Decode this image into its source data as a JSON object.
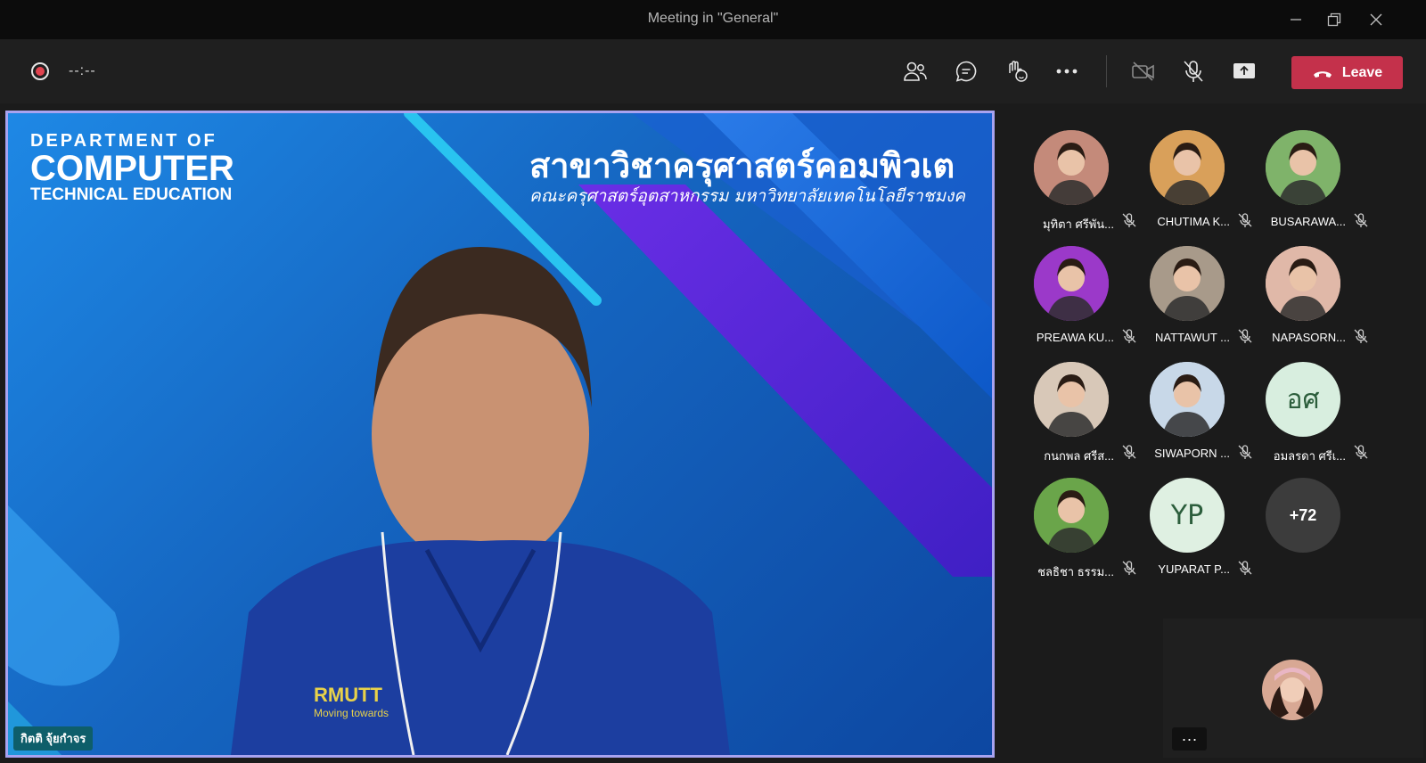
{
  "window": {
    "title": "Meeting in \"General\""
  },
  "toolbar": {
    "timer": "--:--",
    "leave_label": "Leave"
  },
  "stage": {
    "dept_line1": "DEPARTMENT OF",
    "dept_line2": "COMPUTER",
    "dept_line3": "TECHNICAL EDUCATION",
    "thai_title": "สาขาวิชาครุศาสตร์คอมพิวเต",
    "thai_subtitle": "คณะครุศาสตร์อุตสาหกรรม มหาวิทยาลัยเทคโนโลยีราชมงค",
    "shirt_logo": "RMUTT",
    "shirt_tagline": "Moving towards",
    "speaker_name": "กิตติ จุ้ยกำจร"
  },
  "participants": [
    {
      "name": "มุทิตา ศรีพัน...",
      "type": "photo",
      "color": "#c48a7a"
    },
    {
      "name": "CHUTIMA K...",
      "type": "photo",
      "color": "#d9a05a"
    },
    {
      "name": "BUSARAWA...",
      "type": "photo",
      "color": "#7fb36a"
    },
    {
      "name": "PREAWA KU...",
      "type": "photo",
      "color": "#9b39c9"
    },
    {
      "name": "NATTAWUT ...",
      "type": "photo",
      "color": "#a89a8a"
    },
    {
      "name": "NAPASORN...",
      "type": "photo",
      "color": "#e0b8a8"
    },
    {
      "name": "กนกพล ศรีส...",
      "type": "photo",
      "color": "#d8c8b8"
    },
    {
      "name": "SIWAPORN ...",
      "type": "photo",
      "color": "#c8d8e8"
    },
    {
      "name": "อมลรดา ศรีเ...",
      "type": "initials",
      "initials": "อศ",
      "color": "#d8eedf"
    },
    {
      "name": "ชลธิชา ธรรม...",
      "type": "photo",
      "color": "#6aa54a"
    },
    {
      "name": "YUPARAT P...",
      "type": "initials",
      "initials": "YP",
      "color": "#dff0e2"
    },
    {
      "name": "",
      "type": "overflow",
      "label": "+72",
      "color": "#3c3c3c"
    }
  ],
  "self_view": {
    "more_label": "···"
  },
  "colors": {
    "leave": "#c4314b",
    "stage_border": "#a8a3f0",
    "badge": "#0e5e6a"
  }
}
